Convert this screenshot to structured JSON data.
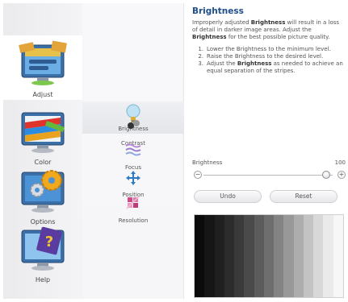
{
  "categories": [
    {
      "label": "Adjust",
      "icon": "adjust-monitor-icon",
      "selected": true
    },
    {
      "label": "Color",
      "icon": "color-monitor-icon",
      "selected": false
    },
    {
      "label": "Options",
      "icon": "options-gear-icon",
      "selected": false
    },
    {
      "label": "Help",
      "icon": "help-monitor-icon",
      "selected": false
    }
  ],
  "sub_items": [
    {
      "label": "Brightness",
      "icon": "lightbulb-icon",
      "selected": true
    },
    {
      "label": "Contrast",
      "icon": "contrast-icon",
      "selected": false
    },
    {
      "label": "Focus",
      "icon": "focus-icon",
      "selected": false
    },
    {
      "label": "Position",
      "icon": "position-arrows-icon",
      "selected": false
    },
    {
      "label": "Resolution",
      "icon": "resolution-icon",
      "selected": false
    }
  ],
  "main": {
    "title": "Brightness",
    "desc_parts": [
      "Improperly adjusted ",
      "Brightness",
      " will result in a loss of detail in darker image areas. Adjust the ",
      "Brightness",
      " for the best possible picture quality."
    ],
    "steps": [
      {
        "num": "1.",
        "text": "Lower the Brightness to the minimum level."
      },
      {
        "num": "2.",
        "text": "Raise the Brightness to the desired level."
      },
      {
        "num": "3.",
        "pre": "Adjust the ",
        "bold": "Brightness",
        "post": " as needed to achieve an equal separation of the stripes."
      }
    ],
    "slider": {
      "label": "Brightness",
      "value": "100",
      "level": 100,
      "minus": "−",
      "plus": "+"
    },
    "undo_label": "Undo",
    "reset_label": "Reset"
  },
  "stripes": [
    "#0b0b0b",
    "#161616",
    "#202020",
    "#2c2c2c",
    "#3a3a3a",
    "#4a4a4a",
    "#5c5c5c",
    "#6e6e6e",
    "#838383",
    "#989898",
    "#adadad",
    "#c3c3c3",
    "#d8d8d8",
    "#eaeaea",
    "#f7f7f7"
  ]
}
